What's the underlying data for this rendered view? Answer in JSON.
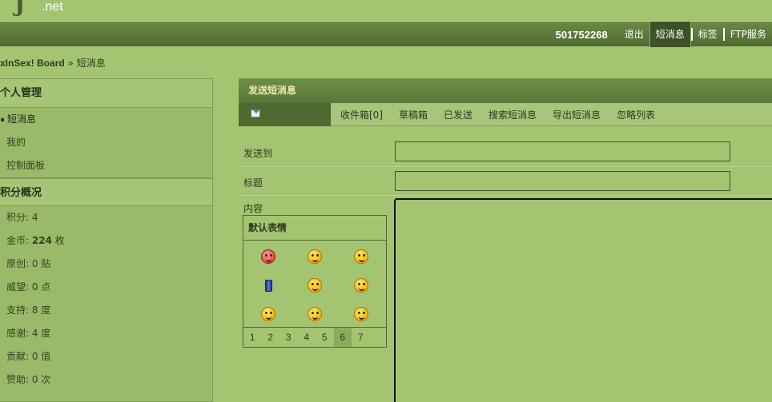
{
  "header": {
    "logo_mark": "J",
    "logo_suffix": ".net"
  },
  "nav": {
    "username": "501752268",
    "links": [
      "退出",
      "短消息",
      "标签",
      "FTP服务"
    ]
  },
  "breadcrumb": {
    "board": "xInSex! Board",
    "sep": " » ",
    "current": "短消息"
  },
  "sidebar": {
    "section1_title": "个人管理",
    "items": [
      "短消息",
      "我的",
      "控制面板"
    ],
    "section2_title": "积分概况",
    "stats": [
      {
        "label": "积分: 4",
        "value": "",
        "unit": ""
      },
      {
        "label": "金币: ",
        "value": "224",
        "unit": " 枚"
      },
      {
        "label": "原创: 0 贴",
        "value": "",
        "unit": ""
      },
      {
        "label": "威望: 0 点",
        "value": "",
        "unit": ""
      },
      {
        "label": "支持: 8 度",
        "value": "",
        "unit": ""
      },
      {
        "label": "感谢: 4 度",
        "value": "",
        "unit": ""
      },
      {
        "label": "贡献: 0 值",
        "value": "",
        "unit": ""
      },
      {
        "label": "赞助: 0 次",
        "value": "",
        "unit": ""
      }
    ]
  },
  "main": {
    "title": "发送短消息",
    "tabs": [
      "收件箱[0]",
      "草稿箱",
      "已发送",
      "搜索短消息",
      "导出短消息",
      "忽略列表"
    ],
    "form": {
      "to_label": "发送到",
      "subject_label": "标题",
      "content_label": "内容",
      "to_value": "",
      "subject_value": "",
      "content_value": ""
    },
    "smilies": {
      "title": "默认表情",
      "pages": [
        "1",
        "2",
        "3",
        "4",
        "5",
        "6",
        "7"
      ],
      "current_page": "6"
    }
  },
  "colors": {
    "background": "#a3c572",
    "navbar": "#4f6a30",
    "title_text": "#f4e9a6"
  }
}
